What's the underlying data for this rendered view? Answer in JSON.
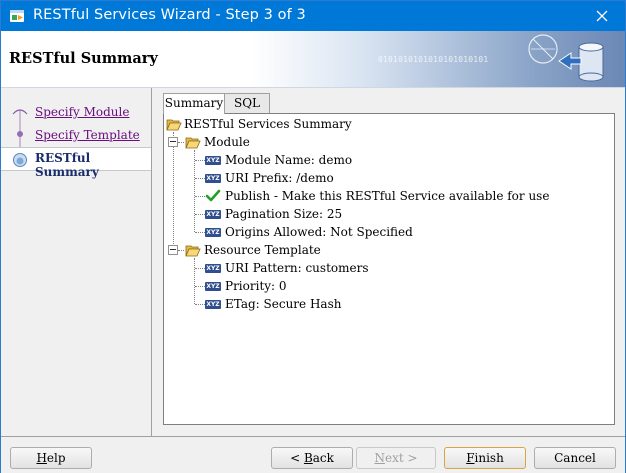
{
  "window": {
    "title": "RESTful Services Wizard - Step 3 of 3",
    "close_glyph": "✕"
  },
  "header": {
    "title": "RESTful Summary",
    "binary_text": "0101010101010101010101"
  },
  "steps": [
    {
      "label": "Specify Module",
      "state": "done"
    },
    {
      "label": "Specify Template",
      "state": "done"
    },
    {
      "label": "RESTful Summary",
      "state": "current"
    }
  ],
  "tabs": [
    {
      "label": "Summary",
      "active": true
    },
    {
      "label": "SQL",
      "active": false
    }
  ],
  "tree": {
    "root": "RESTful Services Summary",
    "module": {
      "label": "Module",
      "items": [
        {
          "label": "Module Name: demo",
          "icon": "xyz-icon"
        },
        {
          "label": "URI Prefix: /demo",
          "icon": "xyz-icon"
        },
        {
          "label": "Publish - Make this RESTful Service available for use",
          "icon": "check-icon"
        },
        {
          "label": "Pagination Size: 25",
          "icon": "xyz-icon"
        },
        {
          "label": "Origins Allowed: Not Specified",
          "icon": "xyz-icon"
        }
      ]
    },
    "template": {
      "label": "Resource Template",
      "items": [
        {
          "label": "URI Pattern: customers",
          "icon": "xyz-icon"
        },
        {
          "label": "Priority: 0",
          "icon": "xyz-icon"
        },
        {
          "label": "ETag: Secure Hash",
          "icon": "xyz-icon"
        }
      ]
    },
    "icon_text": "XYZ"
  },
  "buttons": {
    "help": {
      "pre": "",
      "u": "H",
      "post": "elp"
    },
    "back": {
      "pre": "< ",
      "u": "B",
      "post": "ack"
    },
    "next": {
      "pre": "",
      "u": "N",
      "post": "ext >"
    },
    "finish": {
      "pre": "",
      "u": "F",
      "post": "inish"
    },
    "cancel": {
      "pre": "Cancel",
      "u": "",
      "post": ""
    }
  },
  "colors": {
    "titlebar": "#0078d7",
    "link_visited": "#6a0d80",
    "current_step": "#1a2d6b",
    "check_green": "#22a022"
  }
}
